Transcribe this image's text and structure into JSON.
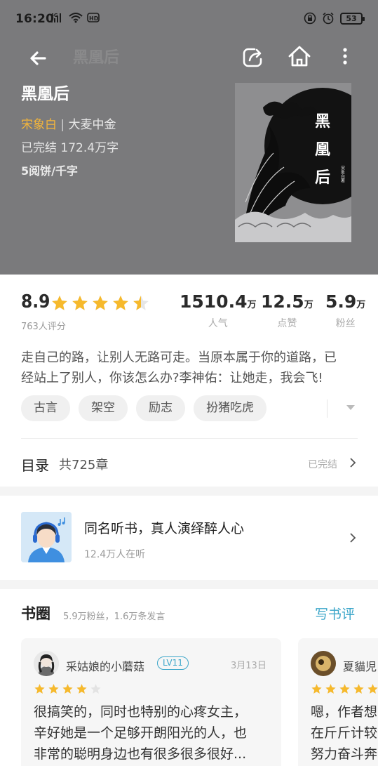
{
  "status_bar": {
    "time": "16:20",
    "network": "4G",
    "battery": "53",
    "icons": [
      "signal-icon",
      "wifi-icon",
      "hd-icon",
      "lock-rotation-icon",
      "alarm-icon",
      "battery-icon"
    ]
  },
  "nav": {
    "ghost_title": "黑凰后",
    "icons": [
      "back-arrow-icon",
      "share-icon",
      "home-icon",
      "more-vertical-icon"
    ]
  },
  "book": {
    "title": "黑凰后",
    "author": "宋象白",
    "separator": " | ",
    "publisher": "大麦中金",
    "status_line": "已完结 172.4万字",
    "price": "5阅饼/千字",
    "cover_text": [
      "黑",
      "凰",
      "后"
    ],
    "cover_author": "宋象白著"
  },
  "stats": {
    "score": "8.9",
    "rating_count": "763人评分",
    "star_rating": 4.5,
    "items": [
      {
        "num": "1510.4",
        "unit": "万",
        "label": "人气"
      },
      {
        "num": "12.5",
        "unit": "万",
        "label": "点赞"
      },
      {
        "num": "5.9",
        "unit": "万",
        "label": "粉丝"
      }
    ]
  },
  "summary": {
    "line1": "走自己的路，让别人无路可走。当原本属于你的道路，已",
    "line2": "经站上了别人，你该怎么办?李神佑：让她走，我会飞!"
  },
  "tags": [
    "古言",
    "架空",
    "励志",
    "扮猪吃虎"
  ],
  "toc": {
    "label": "目录",
    "count": "共725章",
    "status": "已完结"
  },
  "audio": {
    "title": "同名听书，真人演绎醉人心",
    "listeners": "12.4万人在听"
  },
  "circle": {
    "title": "书圈",
    "subtitle": "5.9万粉丝，1.6万条发言",
    "write_label": "写书评",
    "reviews": [
      {
        "name": "采姑娘的小蘑菇",
        "level": "LV11",
        "date": "3月13日",
        "stars": 4,
        "lines": [
          "很搞笑的，同时也特别的心疼女主，",
          "辛好她是一个足够开朗阳光的人，也",
          "非常的聪明身边也有很多很多很好..."
        ]
      },
      {
        "name": "夏貓児",
        "level": "",
        "date": "",
        "stars": 5,
        "lines": [
          "嗯，作者想",
          "在斤斤计较",
          "努力奋斗奔"
        ]
      }
    ]
  },
  "colors": {
    "hero_bg": "#7a7a7c",
    "author_accent": "#f5b63a",
    "link_accent": "#3ba6c9",
    "star": "#f6b92c"
  }
}
